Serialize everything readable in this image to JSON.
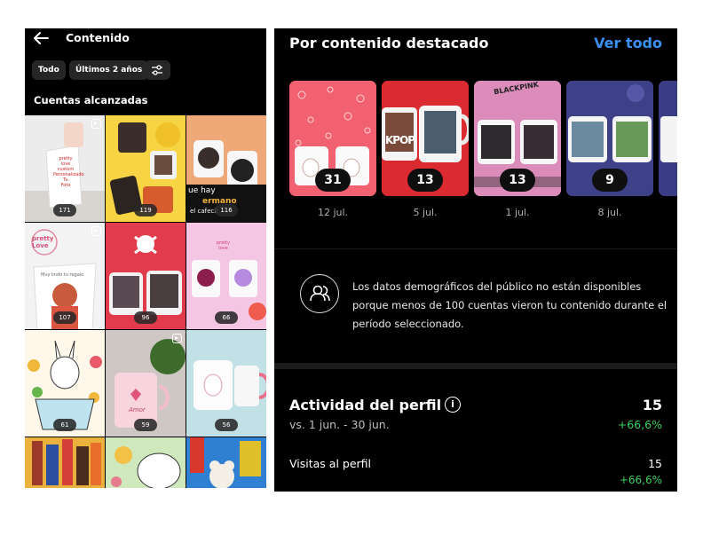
{
  "left_panel": {
    "title": "Contenido",
    "filters": [
      "Todo",
      "Últimos 2 años"
    ],
    "section_title": "Cuentas alcanzadas",
    "posts": [
      {
        "count": "171",
        "reel": true
      },
      {
        "count": "119",
        "reel": false
      },
      {
        "count": "116",
        "reel": false
      },
      {
        "count": "107",
        "reel": true
      },
      {
        "count": "96",
        "reel": false
      },
      {
        "count": "66",
        "reel": false
      },
      {
        "count": "61",
        "reel": false
      },
      {
        "count": "59",
        "reel": true
      },
      {
        "count": "56",
        "reel": false
      },
      {
        "count": "",
        "reel": false
      },
      {
        "count": "",
        "reel": false
      },
      {
        "count": "",
        "reel": false
      }
    ],
    "post_texts": {
      "p1": "pretty\nlove\ncustom\nPersonalizado\nTu\nFoto",
      "p3a": "ue hay",
      "p3b": "ermano",
      "p3c": "el cafecit",
      "p4": "pretty\nLove",
      "p4b": "Muy lindo tu regalo",
      "p5": "pretty\nlove",
      "p6": "pretty\nlove",
      "p8": "Amor"
    }
  },
  "right_panel": {
    "title": "Por contenido destacado",
    "see_all": "Ver todo",
    "cards": [
      {
        "count": "31",
        "date": "12 jul."
      },
      {
        "count": "13",
        "date": "5 jul."
      },
      {
        "count": "13",
        "date": "1 jul."
      },
      {
        "count": "9",
        "date": "8 jul."
      }
    ],
    "demographics_message": "Los datos demográficos del público no están disponibles porque menos de 100 cuentas vieron tu contenido durante el período seleccionado.",
    "activity": {
      "title": "Actividad del perfil",
      "value": "15",
      "comparison": "vs. 1 jun. - 30 jun.",
      "delta": "+66,6%"
    },
    "visits": {
      "label": "Visitas al perfil",
      "value": "15",
      "delta": "+66,6%"
    },
    "card_texts": {
      "c2": "KPOP",
      "c3": "BLACKPINK"
    }
  },
  "colors": {
    "link_blue": "#3a90f4",
    "positive_green": "#3ccf61",
    "background": "#000000"
  },
  "icons": {
    "back": "arrow-left",
    "filter": "sliders",
    "reel": "reel-play",
    "demographics": "people",
    "info": "info-circle"
  }
}
